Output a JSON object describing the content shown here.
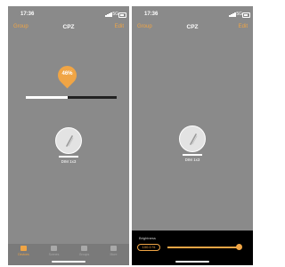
{
  "colors": {
    "accent": "#f0a545",
    "screen": "#8a8a8a",
    "panel": "#000000"
  },
  "left": {
    "status": {
      "time": "17:36",
      "network": "5G"
    },
    "nav": {
      "left": "Group",
      "title": "CPZ",
      "right": "Edit"
    },
    "brightness_badge": "46%",
    "brightness_level": 0.46,
    "device": {
      "name": "DIM 1x3",
      "icon": "lamp-icon"
    },
    "tabs": [
      {
        "label": "Devices",
        "icon": "devices-icon",
        "active": true
      },
      {
        "label": "Scenes",
        "icon": "scenes-icon",
        "active": false
      },
      {
        "label": "Groups",
        "icon": "groups-icon",
        "active": false
      },
      {
        "label": "More",
        "icon": "more-icon",
        "active": false
      }
    ]
  },
  "right": {
    "status": {
      "time": "17:36",
      "network": "5G"
    },
    "nav": {
      "left": "Group",
      "title": "CPZ",
      "right": "Edit"
    },
    "device": {
      "name": "DIM 1x3",
      "icon": "lamp-icon"
    },
    "panel": {
      "label": "Brightness",
      "value": "100.0 %",
      "level": 1.0
    }
  }
}
